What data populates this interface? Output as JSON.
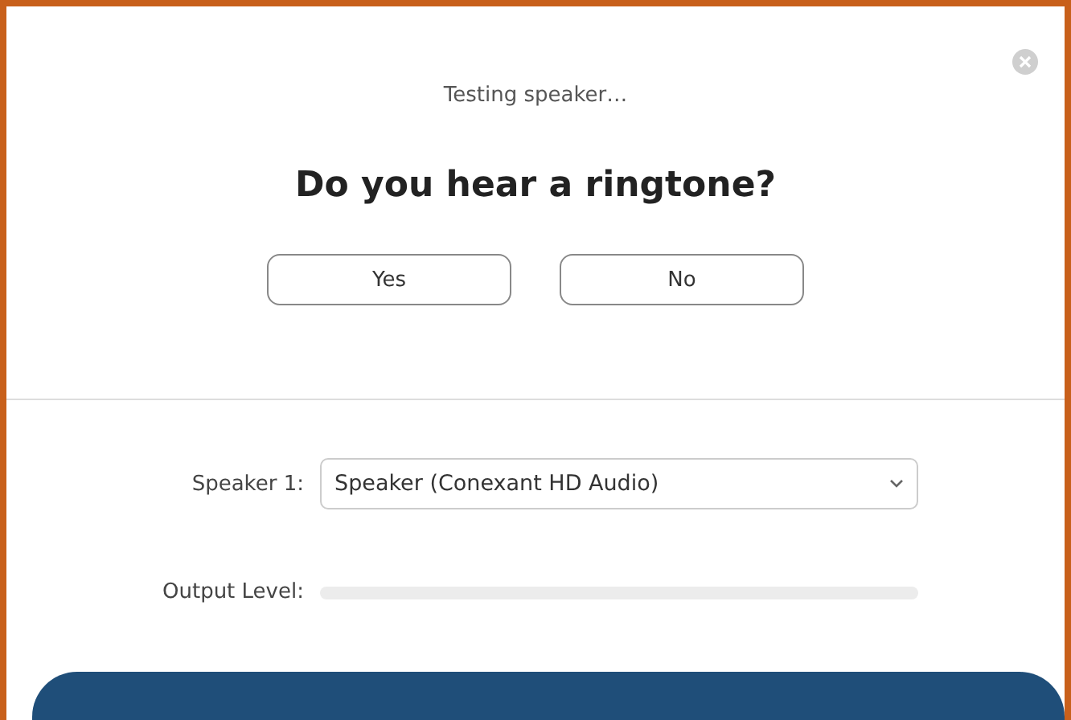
{
  "status": "Testing speaker…",
  "question": "Do you hear a ringtone?",
  "buttons": [
    "Yes",
    "No"
  ],
  "speaker": {
    "label": "Speaker 1:",
    "value": "Speaker (Conexant HD Audio)"
  },
  "output": {
    "label": "Output Level:",
    "level": 0
  }
}
